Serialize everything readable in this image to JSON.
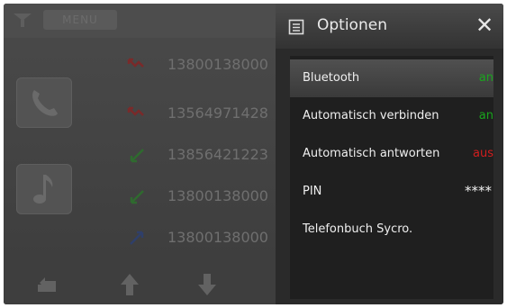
{
  "background_app": {
    "menu_label": "MENU",
    "recent_calls": [
      {
        "number": "13800138000",
        "type": "missed"
      },
      {
        "number": "13564971428",
        "type": "missed"
      },
      {
        "number": "13856421223",
        "type": "received"
      },
      {
        "number": "13800138000",
        "type": "received"
      },
      {
        "number": "13800138000",
        "type": "dialed"
      }
    ]
  },
  "options": {
    "title": "Optionen",
    "items": [
      {
        "label": "Bluetooth",
        "value": "an"
      },
      {
        "label": "Automatisch verbinden",
        "value": "an"
      },
      {
        "label": "Automatisch antworten",
        "value": "aus"
      },
      {
        "label": "PIN",
        "value": "****"
      },
      {
        "label": "Telefonbuch Sycro.",
        "value": ""
      }
    ]
  },
  "colors": {
    "on": "#19a61d",
    "off": "#d11e1e",
    "missed": "#a02020",
    "received": "#2a8a2a",
    "dialed": "#2a4aa0"
  }
}
